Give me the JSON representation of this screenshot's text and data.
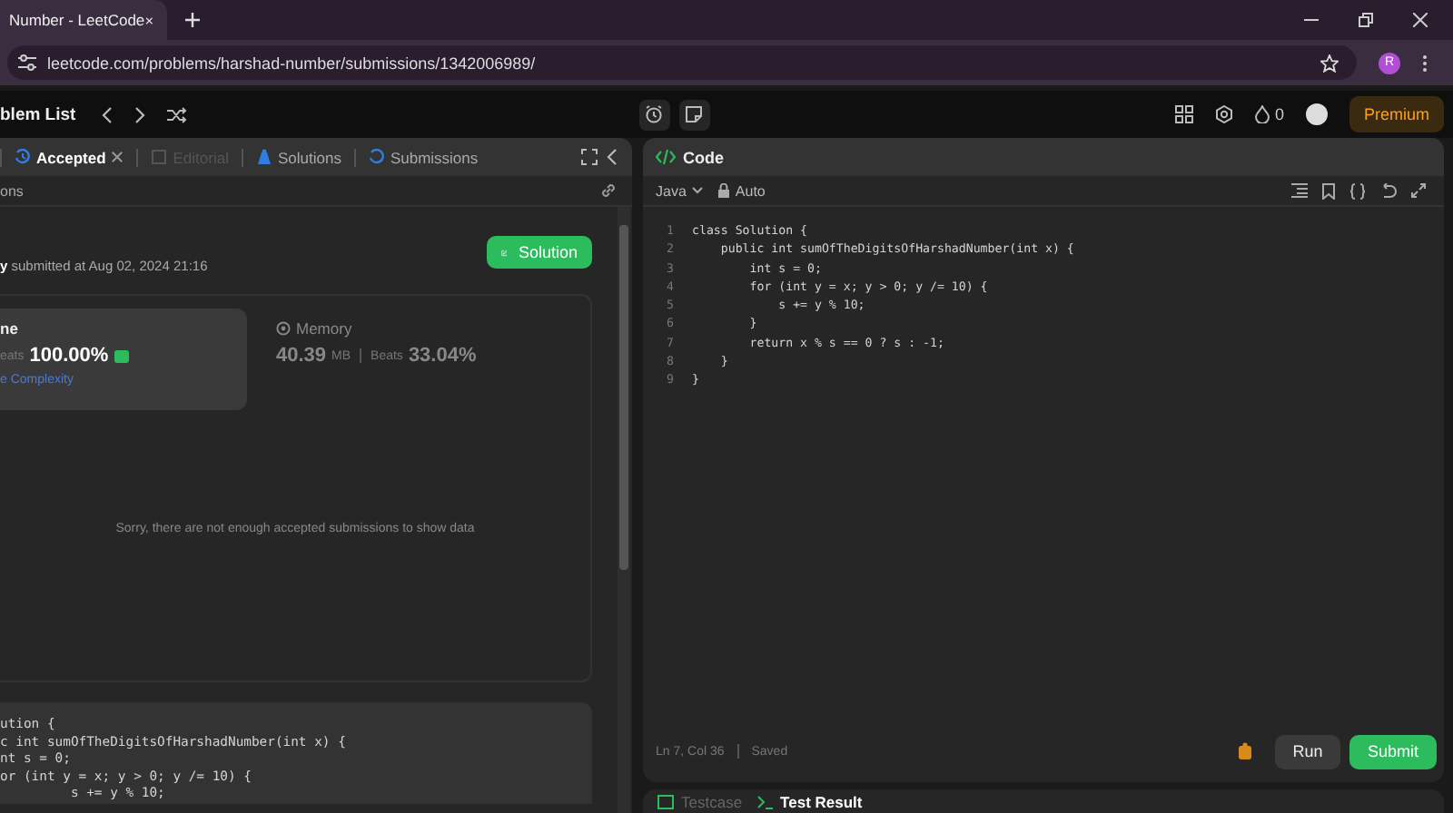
{
  "browser": {
    "tabs": [
      {
        "title": "Number - LeetCode",
        "selected": true
      }
    ],
    "url": "leetcode.com/problems/harshad-number/submissions/1342006989/",
    "profile_initial": "R"
  },
  "topbar": {
    "problem_list": "blem List",
    "streak_count": "0",
    "premium": "Premium"
  },
  "left_panel": {
    "tabs": [
      {
        "label": "Accepted",
        "selected": true,
        "disabled": false,
        "closable": true
      },
      {
        "label": "Editorial",
        "selected": false,
        "disabled": true,
        "closable": false
      },
      {
        "label": "Solutions",
        "selected": false,
        "disabled": false,
        "closable": false
      },
      {
        "label": "Submissions",
        "selected": false,
        "disabled": false,
        "closable": false
      }
    ],
    "breadcrumb": "ons",
    "submitted": "**y** submitted at Aug 02, 2024 21:16",
    "solution_button": "Solution",
    "stats": [
      {
        "title": "ne",
        "beats_label": "eats",
        "beats_value": "100.00%",
        "link": "e Complexity",
        "selected": true
      },
      {
        "title": "Memory",
        "value": "40.39",
        "unit": "MB",
        "beats_label": "Beats",
        "beats_value": "33.04%",
        "selected": false
      }
    ],
    "empty_message": "Sorry, there are not enough accepted submissions to show data",
    "code_preview": [
      "ution {",
      "c int sumOfTheDigitsOfHarshadNumber(int x) {",
      "nt s = 0;",
      "or (int y = x; y > 0; y /= 10) {",
      "         s += y % 10;"
    ]
  },
  "editor": {
    "title": "Code",
    "language": "Java",
    "mode": "Auto",
    "lines": [
      {
        "number": "1",
        "text": "class Solution {"
      },
      {
        "number": "2",
        "text": "    public int sumOfTheDigitsOfHarshadNumber(int x) {"
      },
      {
        "number": "3",
        "text": "        int s = 0;"
      },
      {
        "number": "4",
        "text": "        for (int y = x; y > 0; y /= 10) {"
      },
      {
        "number": "5",
        "text": "            s += y % 10;"
      },
      {
        "number": "6",
        "text": "        }"
      },
      {
        "number": "7",
        "text": "        return x % s == 0 ? s : -1;"
      },
      {
        "number": "8",
        "text": "    }"
      },
      {
        "number": "9",
        "text": "}"
      }
    ],
    "cursor": "Ln 7, Col 36",
    "saved": "Saved",
    "run": "Run",
    "submit": "Submit"
  },
  "bottom_panel": {
    "tabs": [
      {
        "label": "Testcase",
        "selected": false
      },
      {
        "label": "Test Result",
        "selected": true
      }
    ]
  }
}
